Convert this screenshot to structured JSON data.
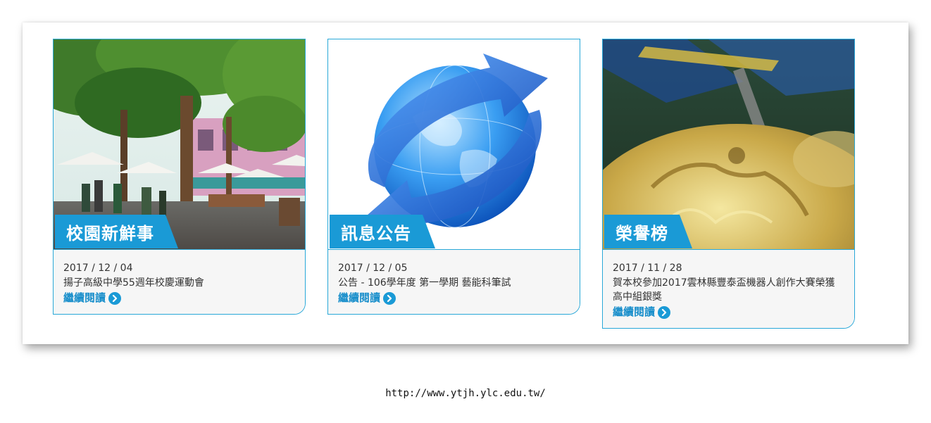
{
  "cards": [
    {
      "tag": "校園新鮮事",
      "date": "2017 / 12 / 04",
      "title": "揚子高級中學55週年校慶運動會",
      "more": "繼續閱讀",
      "image": "campus-photo"
    },
    {
      "tag": "訊息公告",
      "date": "2017 / 12 / 05",
      "title": "公告 - 106學年度 第一學期 藝能科筆試",
      "more": "繼續閱讀",
      "image": "globe-arrows"
    },
    {
      "tag": "榮譽榜",
      "date": "2017 / 11 / 28",
      "title": "賀本校參加2017雲林縣豐泰盃機器人創作大賽榮獲高中組銀獎",
      "more": "繼續閱讀",
      "image": "gold-medal"
    }
  ],
  "footer": {
    "url": "http://www.ytjh.ylc.edu.tw/"
  },
  "colors": {
    "accent": "#1a9ad6",
    "border": "#29a8d8",
    "card_body": "#f6f6f6"
  }
}
